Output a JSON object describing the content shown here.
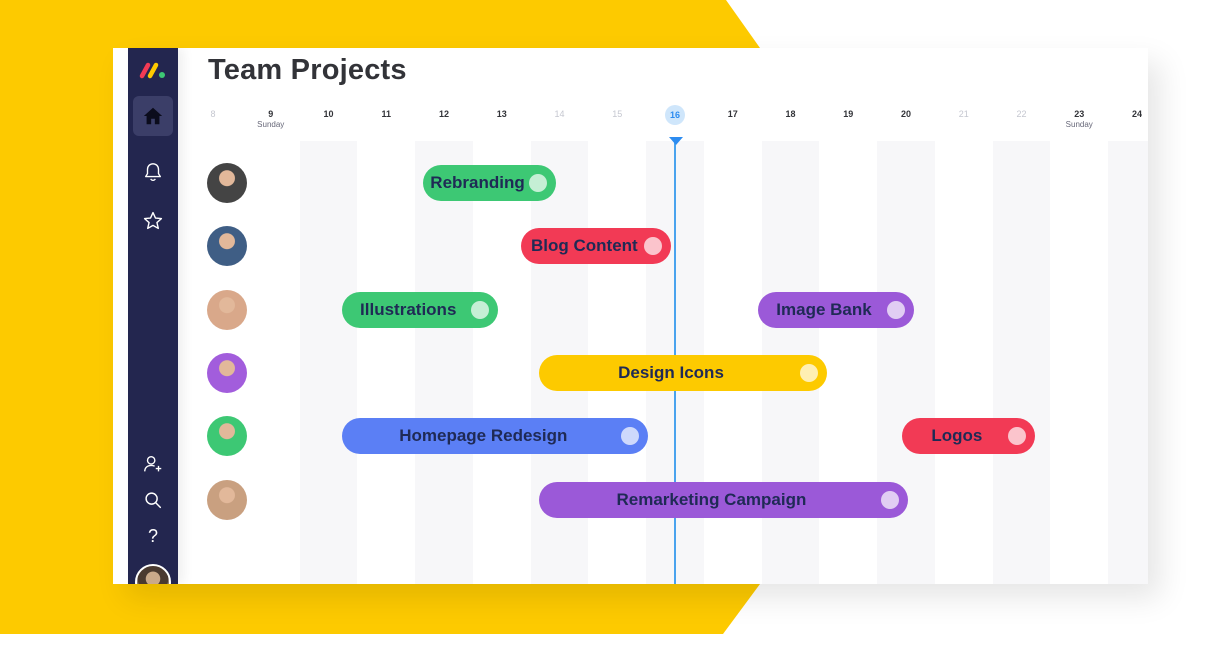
{
  "page": {
    "title": "Team Projects",
    "brand_color": "#fdca00",
    "sidebar_color": "#23264f"
  },
  "sidebar": {
    "items": [
      {
        "name": "home",
        "icon": "home-icon",
        "active": true
      },
      {
        "name": "notifications",
        "icon": "bell-icon",
        "active": false
      },
      {
        "name": "favorites",
        "icon": "star-icon",
        "active": false
      },
      {
        "name": "invite",
        "icon": "add-user-icon",
        "active": false
      },
      {
        "name": "search",
        "icon": "search-icon",
        "active": false
      },
      {
        "name": "help",
        "icon": "help-icon",
        "active": false
      }
    ],
    "help_label": "?"
  },
  "timeline": {
    "days": [
      {
        "num": "8",
        "sub": "",
        "type": "first"
      },
      {
        "num": "9",
        "sub": "Sunday",
        "type": "normal"
      },
      {
        "num": "10",
        "sub": "",
        "type": "normal"
      },
      {
        "num": "11",
        "sub": "",
        "type": "normal"
      },
      {
        "num": "12",
        "sub": "",
        "type": "normal"
      },
      {
        "num": "13",
        "sub": "",
        "type": "normal"
      },
      {
        "num": "14",
        "sub": "",
        "type": "weekend"
      },
      {
        "num": "15",
        "sub": "",
        "type": "weekend"
      },
      {
        "num": "16",
        "sub": "",
        "type": "today"
      },
      {
        "num": "17",
        "sub": "",
        "type": "normal"
      },
      {
        "num": "18",
        "sub": "",
        "type": "normal"
      },
      {
        "num": "19",
        "sub": "",
        "type": "normal"
      },
      {
        "num": "20",
        "sub": "",
        "type": "normal"
      },
      {
        "num": "21",
        "sub": "",
        "type": "weekend"
      },
      {
        "num": "22",
        "sub": "",
        "type": "weekend"
      },
      {
        "num": "23",
        "sub": "Sunday",
        "type": "normal"
      },
      {
        "num": "24",
        "sub": "",
        "type": "normal"
      }
    ],
    "today": "16",
    "rows": [
      {
        "person": "person-1",
        "avatar_color": "#444444",
        "tasks": [
          {
            "label": "Rebranding",
            "color": "#3dc874",
            "start_day": 12.0,
            "end_day": 14.3
          }
        ]
      },
      {
        "person": "person-2",
        "avatar_color": "#3f5e85",
        "tasks": [
          {
            "label": "Blog Content",
            "color": "#f23a55",
            "start_day": 13.7,
            "end_day": 16.3
          }
        ]
      },
      {
        "person": "person-3",
        "avatar_color": "#d9a88a",
        "tasks": [
          {
            "label": "Illustrations",
            "color": "#3dc874",
            "start_day": 10.6,
            "end_day": 13.3
          },
          {
            "label": "Image Bank",
            "color": "#9b59d8",
            "start_day": 17.8,
            "end_day": 20.5
          }
        ]
      },
      {
        "person": "person-4",
        "avatar_color": "#a25ddc",
        "tasks": [
          {
            "label": "Design Icons",
            "color": "#fdca00",
            "start_day": 14.0,
            "end_day": 19.0
          }
        ]
      },
      {
        "person": "person-5",
        "avatar_color": "#3dc874",
        "tasks": [
          {
            "label": "Homepage Redesign",
            "color": "#5b7ff5",
            "start_day": 10.6,
            "end_day": 15.9
          },
          {
            "label": "Logos",
            "color": "#f23a55",
            "start_day": 20.3,
            "end_day": 22.6
          }
        ]
      },
      {
        "person": "person-6",
        "avatar_color": "#c9a080",
        "tasks": [
          {
            "label": "Remarketing Campaign",
            "color": "#9b59d8",
            "start_day": 14.0,
            "end_day": 20.4
          }
        ]
      }
    ]
  }
}
